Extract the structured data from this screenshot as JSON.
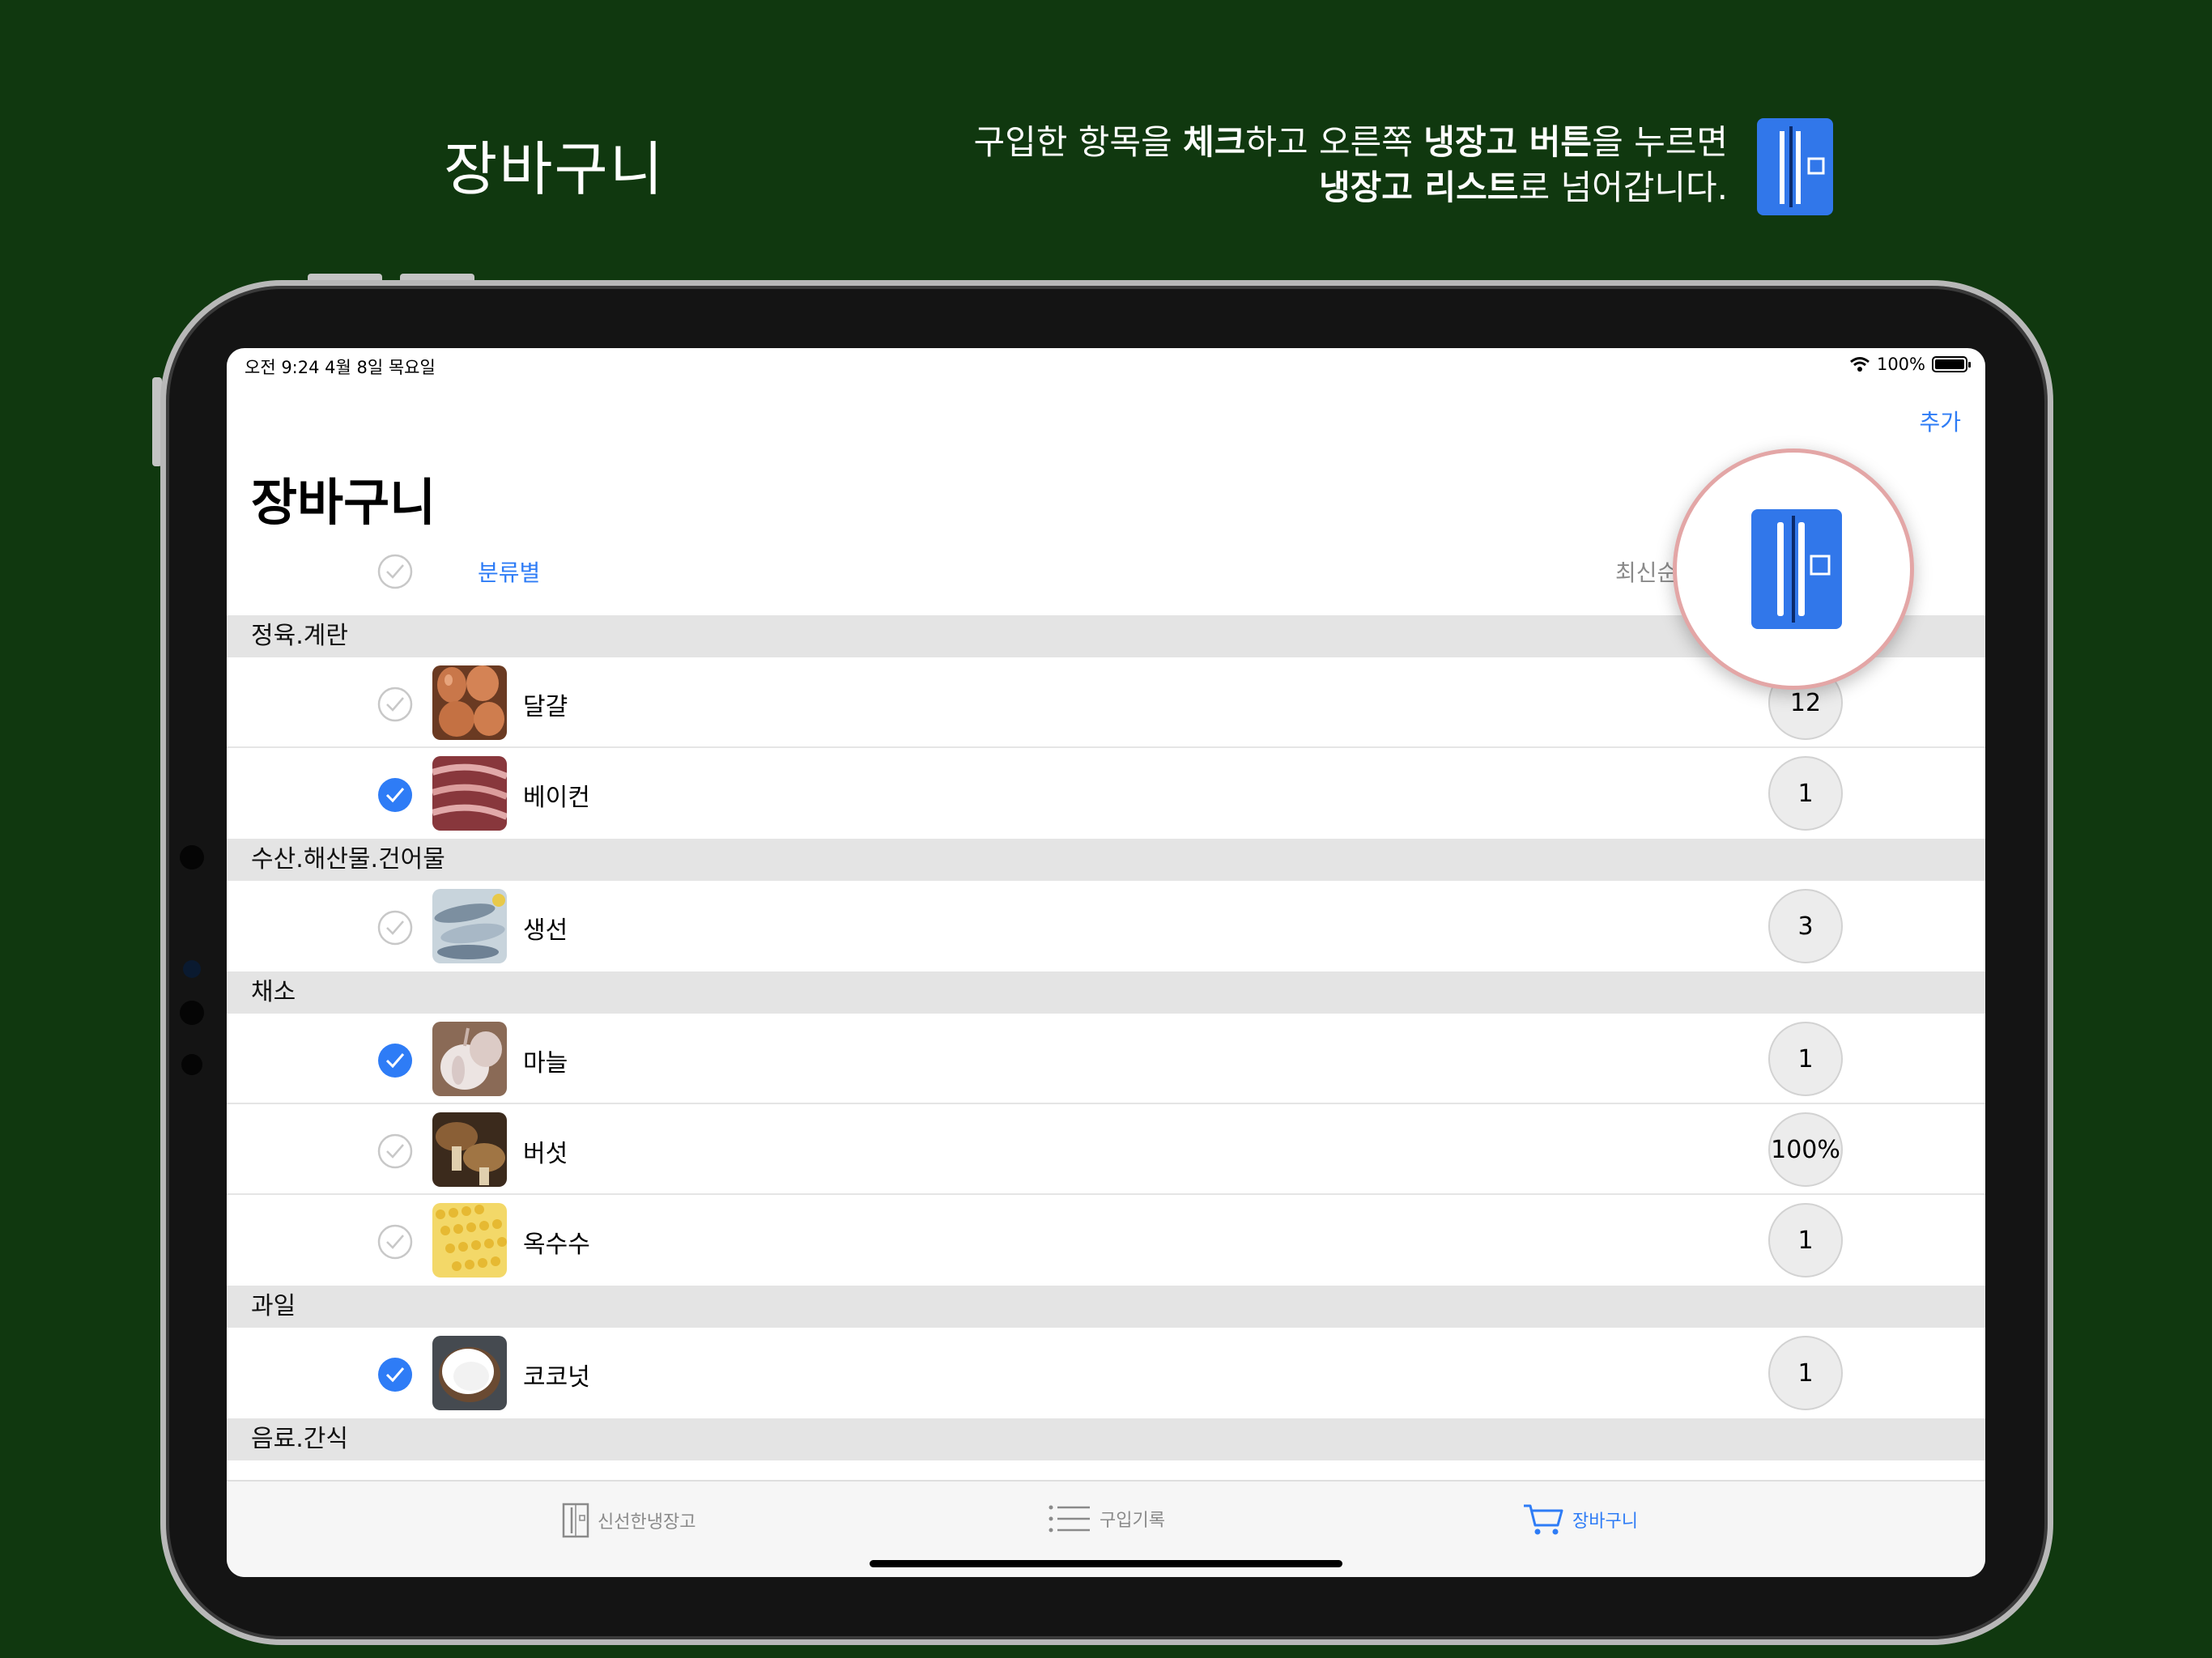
{
  "promo": {
    "title": "장바구니",
    "desc_line1_a": "구입한 항목을 ",
    "desc_line1_b": "체크",
    "desc_line1_c": "하고 오른쪽 ",
    "desc_line1_d": "냉장고 버튼",
    "desc_line1_e": "을 누르면",
    "desc_line2_a": "냉장고 리스트",
    "desc_line2_b": "로 넘어갑니다."
  },
  "status": {
    "time_date": "오전 9:24   4월 8일 목요일",
    "battery": "100%"
  },
  "nav": {
    "add_label": "추가"
  },
  "screen_title": "장바구니",
  "sort": {
    "category_label": "분류별",
    "latest_label": "최신순"
  },
  "sections": [
    {
      "title": "정육.계란",
      "items": [
        {
          "name": "달걀",
          "qty": "12",
          "checked": false,
          "thumb": "eggs"
        },
        {
          "name": "베이컨",
          "qty": "1",
          "checked": true,
          "thumb": "bacon"
        }
      ]
    },
    {
      "title": "수산.해산물.건어물",
      "items": [
        {
          "name": "생선",
          "qty": "3",
          "checked": false,
          "thumb": "fish"
        }
      ]
    },
    {
      "title": "채소",
      "items": [
        {
          "name": "마늘",
          "qty": "1",
          "checked": true,
          "thumb": "garlic"
        },
        {
          "name": "버섯",
          "qty": "100%",
          "checked": false,
          "thumb": "mushroom"
        },
        {
          "name": "옥수수",
          "qty": "1",
          "checked": false,
          "thumb": "corn"
        }
      ]
    },
    {
      "title": "과일",
      "items": [
        {
          "name": "코코넛",
          "qty": "1",
          "checked": true,
          "thumb": "coconut"
        }
      ]
    },
    {
      "title": "음료.간식",
      "items": []
    }
  ],
  "tabs": [
    {
      "label": "신선한냉장고",
      "icon": "fridge-icon",
      "active": false
    },
    {
      "label": "구입기록",
      "icon": "list-icon",
      "active": false
    },
    {
      "label": "장바구니",
      "icon": "cart-icon",
      "active": true
    }
  ],
  "colors": {
    "accent": "#2e7cf6",
    "background": "#10380f",
    "fridge_button": "#3177ea"
  }
}
